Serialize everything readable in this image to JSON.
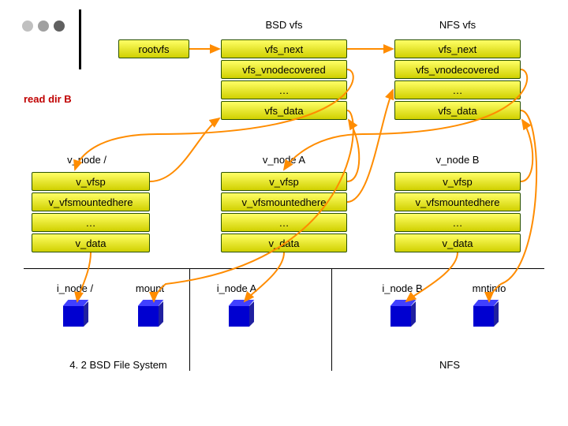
{
  "headers": {
    "bsd_vfs": "BSD vfs",
    "nfs_vfs": "NFS vfs"
  },
  "rootvfs": "rootvfs",
  "read_dir_b": "read dir B",
  "vfs_col1": {
    "next": "vfs_next",
    "vnodecovered": "vfs_vnodecovered",
    "dots": "…",
    "data": "vfs_data"
  },
  "vfs_col2": {
    "next": "vfs_next",
    "vnodecovered": "vfs_vnodecovered",
    "dots": "…",
    "data": "vfs_data"
  },
  "vnode": {
    "slash": "v_node /",
    "a": "v_node A",
    "b": "v_node B"
  },
  "v_col": {
    "vfsp": "v_vfsp",
    "mountedhere": "v_vfsmountedhere",
    "dots": "…",
    "data": "v_data"
  },
  "inodes": {
    "slash": "i_node /",
    "mount": "mount",
    "a": "i_node A",
    "b": "i_node B",
    "mntinfo": "mntinfo"
  },
  "footers": {
    "bsd": "4. 2 BSD File System",
    "nfs": "NFS"
  }
}
